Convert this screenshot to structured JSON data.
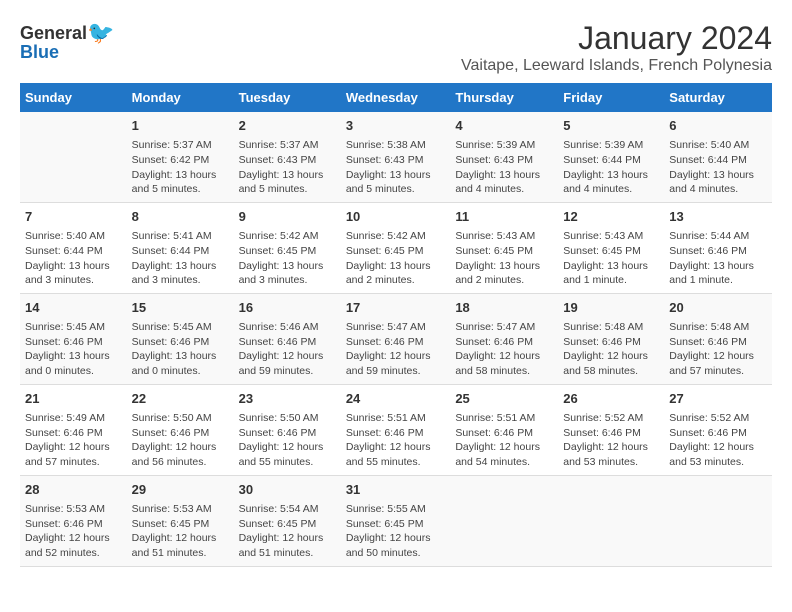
{
  "logo": {
    "general": "General",
    "blue": "Blue"
  },
  "title": "January 2024",
  "subtitle": "Vaitape, Leeward Islands, French Polynesia",
  "days_header": [
    "Sunday",
    "Monday",
    "Tuesday",
    "Wednesday",
    "Thursday",
    "Friday",
    "Saturday"
  ],
  "weeks": [
    [
      {
        "day": "",
        "info": ""
      },
      {
        "day": "1",
        "info": "Sunrise: 5:37 AM\nSunset: 6:42 PM\nDaylight: 13 hours\nand 5 minutes."
      },
      {
        "day": "2",
        "info": "Sunrise: 5:37 AM\nSunset: 6:43 PM\nDaylight: 13 hours\nand 5 minutes."
      },
      {
        "day": "3",
        "info": "Sunrise: 5:38 AM\nSunset: 6:43 PM\nDaylight: 13 hours\nand 5 minutes."
      },
      {
        "day": "4",
        "info": "Sunrise: 5:39 AM\nSunset: 6:43 PM\nDaylight: 13 hours\nand 4 minutes."
      },
      {
        "day": "5",
        "info": "Sunrise: 5:39 AM\nSunset: 6:44 PM\nDaylight: 13 hours\nand 4 minutes."
      },
      {
        "day": "6",
        "info": "Sunrise: 5:40 AM\nSunset: 6:44 PM\nDaylight: 13 hours\nand 4 minutes."
      }
    ],
    [
      {
        "day": "7",
        "info": "Sunrise: 5:40 AM\nSunset: 6:44 PM\nDaylight: 13 hours\nand 3 minutes."
      },
      {
        "day": "8",
        "info": "Sunrise: 5:41 AM\nSunset: 6:44 PM\nDaylight: 13 hours\nand 3 minutes."
      },
      {
        "day": "9",
        "info": "Sunrise: 5:42 AM\nSunset: 6:45 PM\nDaylight: 13 hours\nand 3 minutes."
      },
      {
        "day": "10",
        "info": "Sunrise: 5:42 AM\nSunset: 6:45 PM\nDaylight: 13 hours\nand 2 minutes."
      },
      {
        "day": "11",
        "info": "Sunrise: 5:43 AM\nSunset: 6:45 PM\nDaylight: 13 hours\nand 2 minutes."
      },
      {
        "day": "12",
        "info": "Sunrise: 5:43 AM\nSunset: 6:45 PM\nDaylight: 13 hours\nand 1 minute."
      },
      {
        "day": "13",
        "info": "Sunrise: 5:44 AM\nSunset: 6:46 PM\nDaylight: 13 hours\nand 1 minute."
      }
    ],
    [
      {
        "day": "14",
        "info": "Sunrise: 5:45 AM\nSunset: 6:46 PM\nDaylight: 13 hours\nand 0 minutes."
      },
      {
        "day": "15",
        "info": "Sunrise: 5:45 AM\nSunset: 6:46 PM\nDaylight: 13 hours\nand 0 minutes."
      },
      {
        "day": "16",
        "info": "Sunrise: 5:46 AM\nSunset: 6:46 PM\nDaylight: 12 hours\nand 59 minutes."
      },
      {
        "day": "17",
        "info": "Sunrise: 5:47 AM\nSunset: 6:46 PM\nDaylight: 12 hours\nand 59 minutes."
      },
      {
        "day": "18",
        "info": "Sunrise: 5:47 AM\nSunset: 6:46 PM\nDaylight: 12 hours\nand 58 minutes."
      },
      {
        "day": "19",
        "info": "Sunrise: 5:48 AM\nSunset: 6:46 PM\nDaylight: 12 hours\nand 58 minutes."
      },
      {
        "day": "20",
        "info": "Sunrise: 5:48 AM\nSunset: 6:46 PM\nDaylight: 12 hours\nand 57 minutes."
      }
    ],
    [
      {
        "day": "21",
        "info": "Sunrise: 5:49 AM\nSunset: 6:46 PM\nDaylight: 12 hours\nand 57 minutes."
      },
      {
        "day": "22",
        "info": "Sunrise: 5:50 AM\nSunset: 6:46 PM\nDaylight: 12 hours\nand 56 minutes."
      },
      {
        "day": "23",
        "info": "Sunrise: 5:50 AM\nSunset: 6:46 PM\nDaylight: 12 hours\nand 55 minutes."
      },
      {
        "day": "24",
        "info": "Sunrise: 5:51 AM\nSunset: 6:46 PM\nDaylight: 12 hours\nand 55 minutes."
      },
      {
        "day": "25",
        "info": "Sunrise: 5:51 AM\nSunset: 6:46 PM\nDaylight: 12 hours\nand 54 minutes."
      },
      {
        "day": "26",
        "info": "Sunrise: 5:52 AM\nSunset: 6:46 PM\nDaylight: 12 hours\nand 53 minutes."
      },
      {
        "day": "27",
        "info": "Sunrise: 5:52 AM\nSunset: 6:46 PM\nDaylight: 12 hours\nand 53 minutes."
      }
    ],
    [
      {
        "day": "28",
        "info": "Sunrise: 5:53 AM\nSunset: 6:46 PM\nDaylight: 12 hours\nand 52 minutes."
      },
      {
        "day": "29",
        "info": "Sunrise: 5:53 AM\nSunset: 6:45 PM\nDaylight: 12 hours\nand 51 minutes."
      },
      {
        "day": "30",
        "info": "Sunrise: 5:54 AM\nSunset: 6:45 PM\nDaylight: 12 hours\nand 51 minutes."
      },
      {
        "day": "31",
        "info": "Sunrise: 5:55 AM\nSunset: 6:45 PM\nDaylight: 12 hours\nand 50 minutes."
      },
      {
        "day": "",
        "info": ""
      },
      {
        "day": "",
        "info": ""
      },
      {
        "day": "",
        "info": ""
      }
    ]
  ]
}
